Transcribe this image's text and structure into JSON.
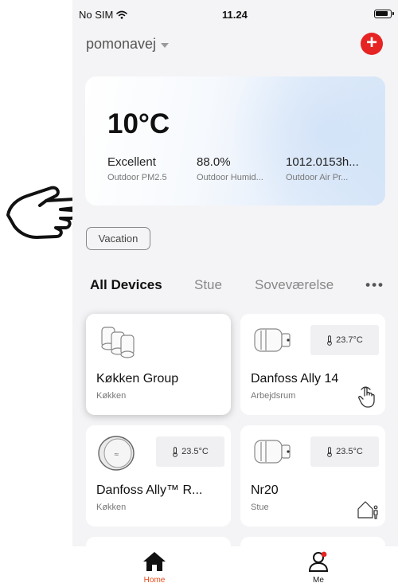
{
  "status_bar": {
    "carrier": "No SIM",
    "time": "11.24"
  },
  "header": {
    "home_name": "pomonavej",
    "add_icon": "plus-icon"
  },
  "weather": {
    "temperature": "10°C",
    "stats": [
      {
        "value": "Excellent",
        "label": "Outdoor PM2.5"
      },
      {
        "value": "88.0%",
        "label": "Outdoor Humid..."
      },
      {
        "value": "1012.0153h...",
        "label": "Outdoor Air Pr..."
      }
    ]
  },
  "vacation_label": "Vacation",
  "tabs": [
    {
      "label": "All Devices",
      "active": true
    },
    {
      "label": "Stue"
    },
    {
      "label": "Soveværelse"
    }
  ],
  "devices": [
    {
      "name": "Køkken Group",
      "room": "Køkken",
      "icon": "thermostat-group-icon",
      "selected": true
    },
    {
      "name": "Danfoss Ally 14",
      "room": "Arbejdsrum",
      "temp": "23.7°C",
      "icon": "radiator-thermostat-icon",
      "corner_icon": "touch-hand-icon"
    },
    {
      "name": "Danfoss Ally™ R...",
      "room": "Køkken",
      "temp": "23.5°C",
      "icon": "room-sensor-icon"
    },
    {
      "name": "Nr20",
      "room": "Stue",
      "temp": "23.5°C",
      "icon": "radiator-thermostat-icon",
      "corner_icon": "home-away-icon"
    }
  ],
  "bottom_nav": [
    {
      "label": "Home",
      "active": true,
      "icon": "home-icon"
    },
    {
      "label": "Me",
      "icon": "person-icon"
    }
  ],
  "colors": {
    "accent_red": "#e62424",
    "active_nav_label": "#e64a19"
  }
}
